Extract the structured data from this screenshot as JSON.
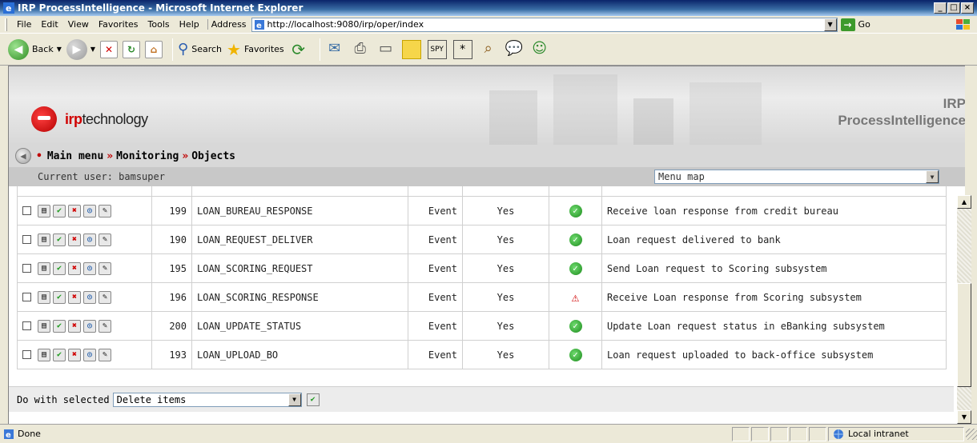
{
  "window": {
    "title": "IRP ProcessIntelligence - Microsoft Internet Explorer",
    "buttons": [
      "_",
      "□",
      "×"
    ]
  },
  "menubar": {
    "items": [
      "File",
      "Edit",
      "View",
      "Favorites",
      "Tools",
      "Help"
    ],
    "address_label": "Address",
    "url": "http://localhost:9080/irp/oper/index",
    "go_label": "Go"
  },
  "toolbar": {
    "back_label": "Back",
    "search_label": "Search",
    "favorites_label": "Favorites"
  },
  "app": {
    "logo_text_irp": "irp",
    "logo_text_rest": "technology",
    "product_line1": "IRP",
    "product_line2": "ProcessIntelligence"
  },
  "breadcrumb": {
    "items": [
      "Main menu",
      "Monitoring",
      "Objects"
    ],
    "separator": "»"
  },
  "userbar": {
    "current_user": "Current user: bamsuper",
    "menu_map": "Menu map"
  },
  "table": {
    "rows": [
      {
        "id": "199",
        "name": "LOAN_BUREAU_RESPONSE",
        "type": "Event",
        "active": "Yes",
        "status": "ok",
        "description": "Receive loan response from credit bureau"
      },
      {
        "id": "190",
        "name": "LOAN_REQUEST_DELIVER",
        "type": "Event",
        "active": "Yes",
        "status": "ok",
        "description": "Loan request delivered to bank"
      },
      {
        "id": "195",
        "name": "LOAN_SCORING_REQUEST",
        "type": "Event",
        "active": "Yes",
        "status": "ok",
        "description": "Send Loan request to Scoring subsystem"
      },
      {
        "id": "196",
        "name": "LOAN_SCORING_RESPONSE",
        "type": "Event",
        "active": "Yes",
        "status": "warning",
        "description": "Receive Loan response from Scoring subsystem"
      },
      {
        "id": "200",
        "name": "LOAN_UPDATE_STATUS",
        "type": "Event",
        "active": "Yes",
        "status": "ok",
        "description": "Update Loan request status in eBanking subsystem"
      },
      {
        "id": "193",
        "name": "LOAN_UPLOAD_BO",
        "type": "Event",
        "active": "Yes",
        "status": "ok",
        "description": "Loan request uploaded to back-office subsystem"
      }
    ]
  },
  "bulk": {
    "label": "Do with selected",
    "selected_action": "Delete items"
  },
  "statusbar": {
    "text": "Done",
    "zone": "Local intranet"
  },
  "colors": {
    "titlebar": "#0a246a",
    "accent_red": "#c00000",
    "ok_green": "#1d8a1d"
  }
}
